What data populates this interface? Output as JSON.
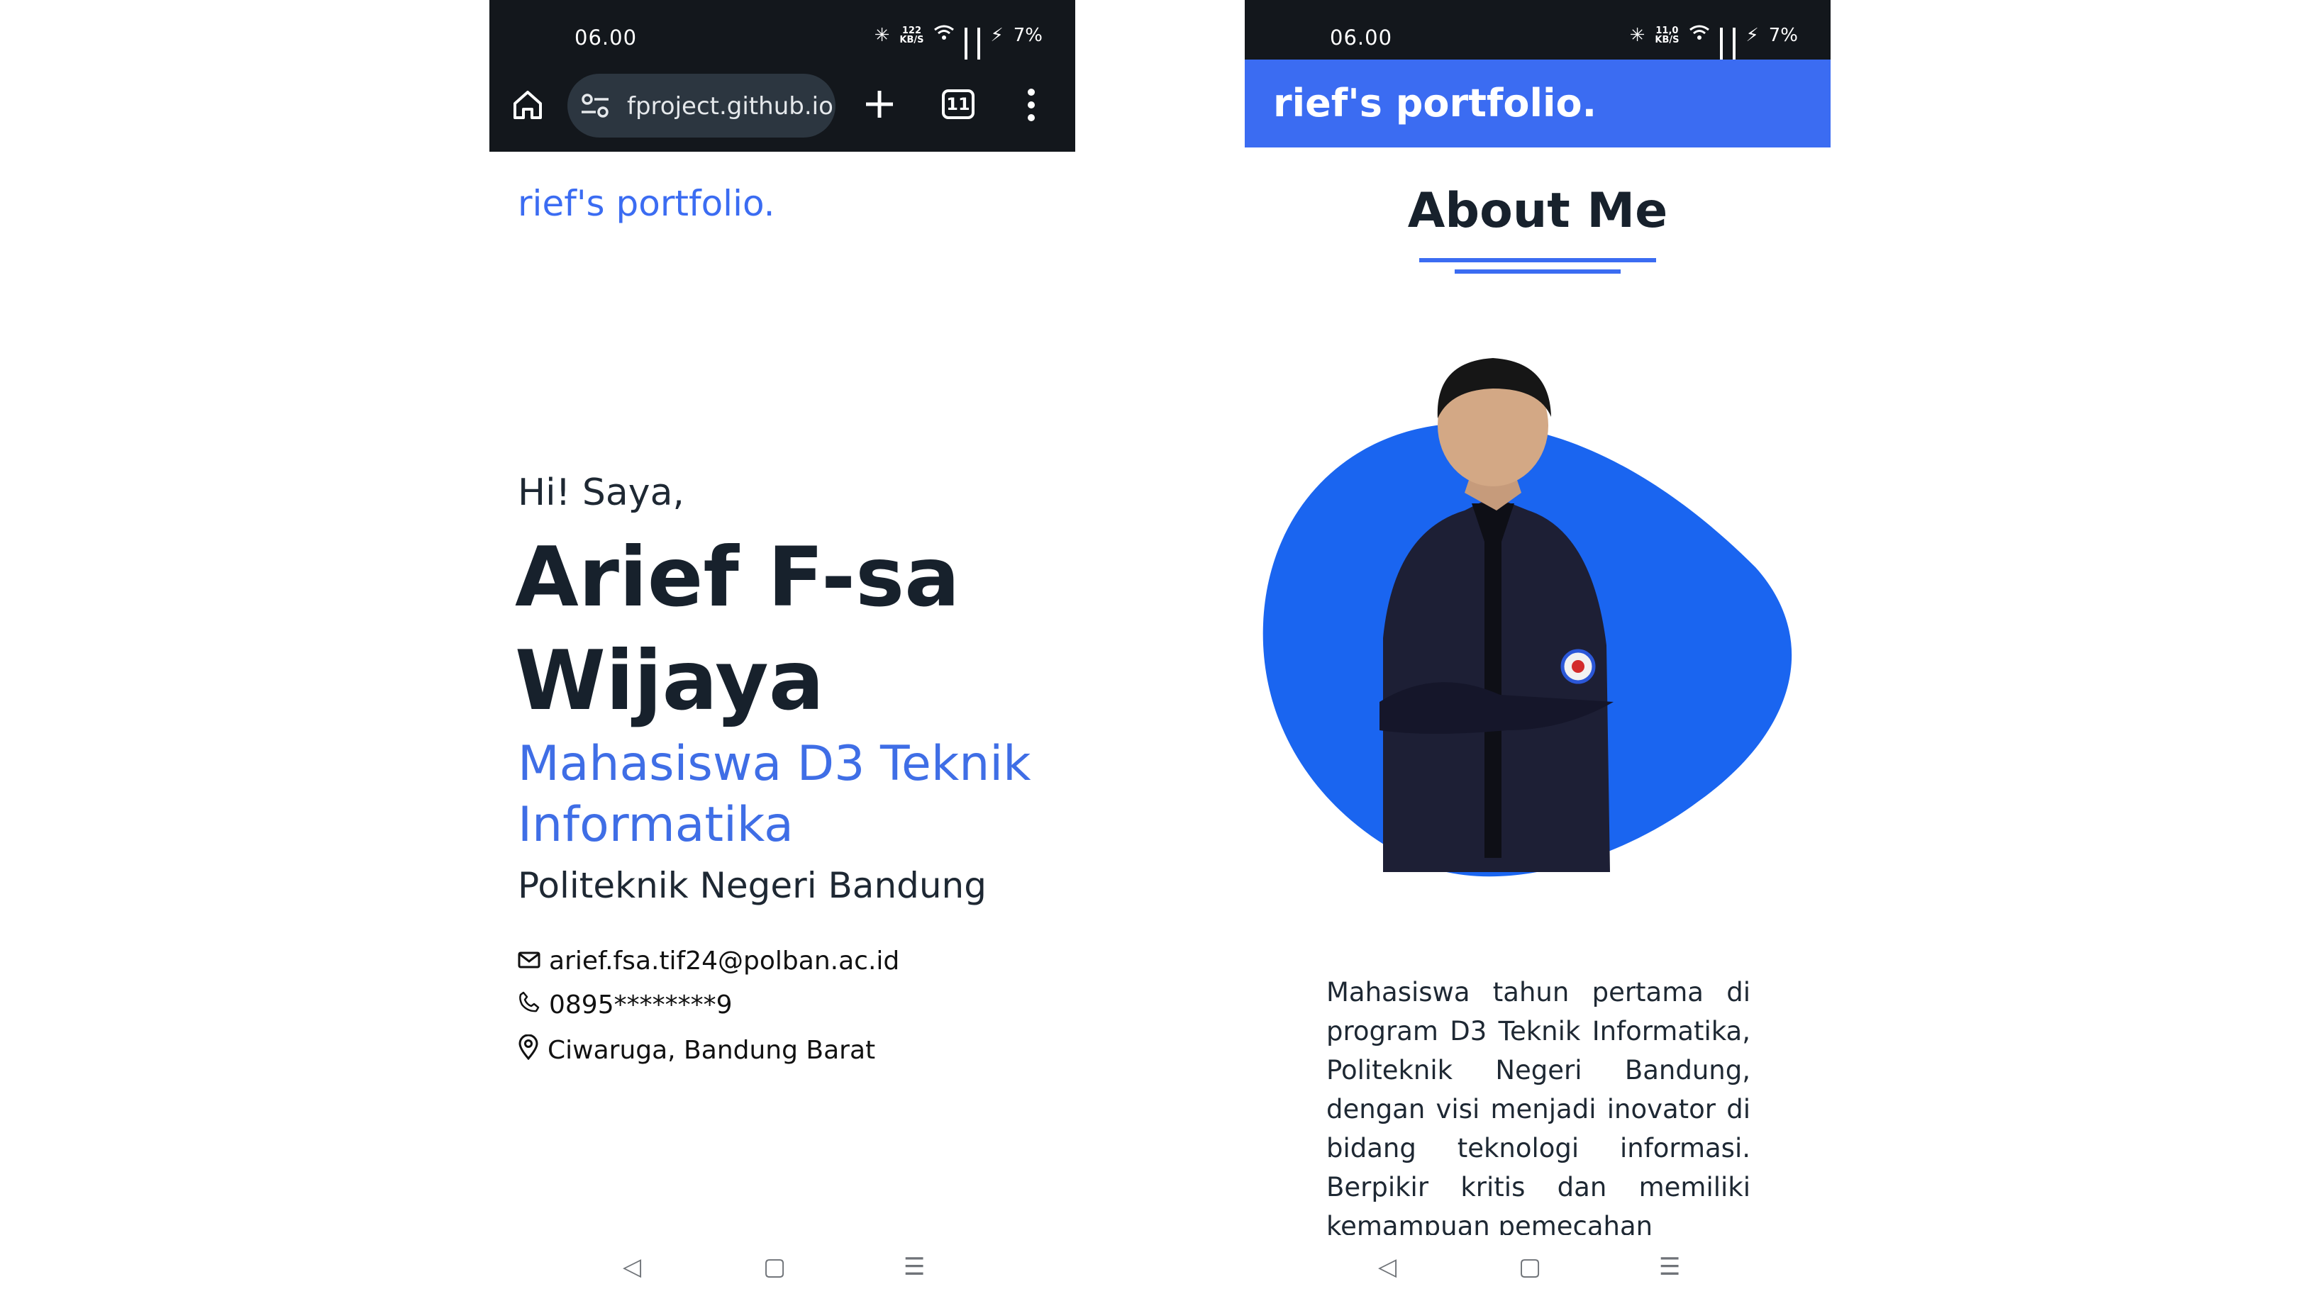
{
  "status": {
    "time": "06.00",
    "left_speed_value": "122",
    "right_speed_value": "11,0",
    "speed_unit": "KB/S",
    "battery": "7%"
  },
  "browser": {
    "url": "fproject.github.io",
    "tab_count": "11"
  },
  "site": {
    "brand": "rief's portfolio."
  },
  "hero": {
    "greeting": "Hi! Saya,",
    "name_line1": "Arief F-sa",
    "name_line2": "Wijaya",
    "role_line1": "Mahasiswa D3 Teknik",
    "role_line2": "Informatika",
    "school": "Politeknik Negeri Bandung",
    "email": "arief.fsa.tif24@polban.ac.id",
    "phone": "0895********9",
    "location": "Ciwaruga, Bandung Barat"
  },
  "about": {
    "title": "About Me",
    "text": "Mahasiswa tahun pertama di program D3 Teknik Informatika, Politeknik Negeri Bandung, dengan visi menjadi inovator di bidang teknologi informasi. Berpikir kritis dan memiliki kemampuan pemecahan"
  },
  "colors": {
    "accent": "#3b6cf2",
    "dark": "#13171c",
    "text": "#17212c"
  }
}
